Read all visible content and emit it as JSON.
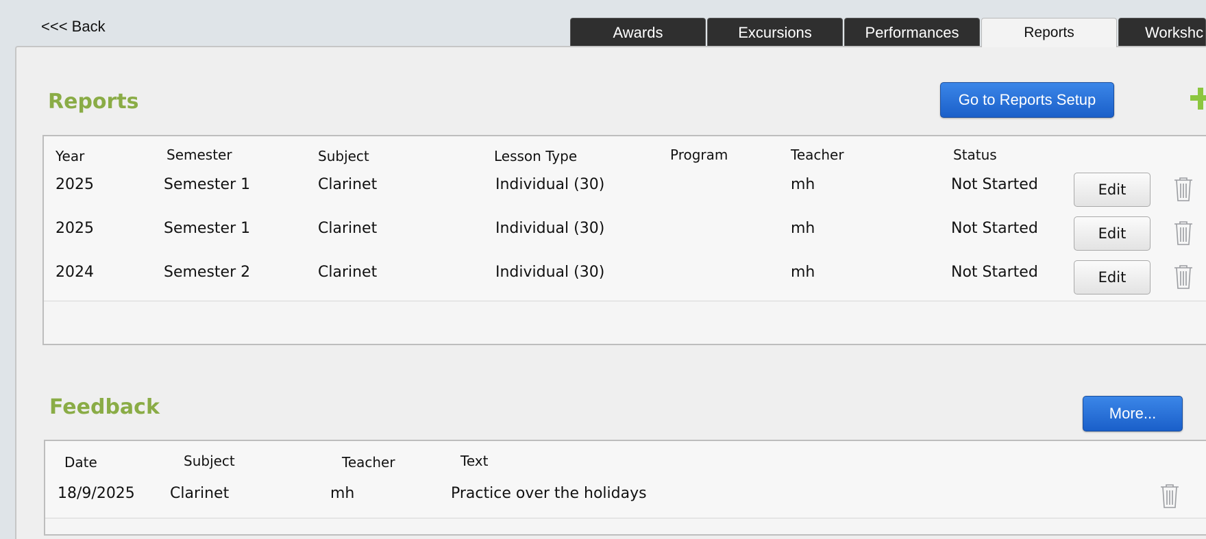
{
  "nav": {
    "back_label": "<<< Back"
  },
  "tabs": [
    {
      "label": "Awards"
    },
    {
      "label": "Excursions"
    },
    {
      "label": "Performances"
    },
    {
      "label": "Reports",
      "active": true
    },
    {
      "label": "Workshc"
    }
  ],
  "reports": {
    "title": "Reports",
    "setup_button": "Go to Reports Setup",
    "columns": [
      "Year",
      "Semester",
      "Subject",
      "Lesson Type",
      "Program",
      "Teacher",
      "Status"
    ],
    "rows": [
      {
        "year": "2025",
        "semester": "Semester 1",
        "subject": "Clarinet",
        "lesson_type": "Individual (30)",
        "program": "",
        "teacher": "mh",
        "status": "Not Started",
        "edit": "Edit"
      },
      {
        "year": "2025",
        "semester": "Semester 1",
        "subject": "Clarinet",
        "lesson_type": "Individual (30)",
        "program": "",
        "teacher": "mh",
        "status": "Not Started",
        "edit": "Edit"
      },
      {
        "year": "2024",
        "semester": "Semester 2",
        "subject": "Clarinet",
        "lesson_type": "Individual (30)",
        "program": "",
        "teacher": "mh",
        "status": "Not Started",
        "edit": "Edit"
      }
    ]
  },
  "feedback": {
    "title": "Feedback",
    "more_button": "More...",
    "columns": [
      "Date",
      "Subject",
      "Teacher",
      "Text"
    ],
    "rows": [
      {
        "date": "18/9/2025",
        "subject": "Clarinet",
        "teacher": "mh",
        "text": "Practice over the holidays"
      }
    ]
  },
  "colors": {
    "accent_green": "#8aac46",
    "button_blue": "#1a5fc9",
    "tab_dark": "#2f2f2f"
  },
  "icons": {
    "add": "plus-icon",
    "delete": "trash-icon"
  }
}
